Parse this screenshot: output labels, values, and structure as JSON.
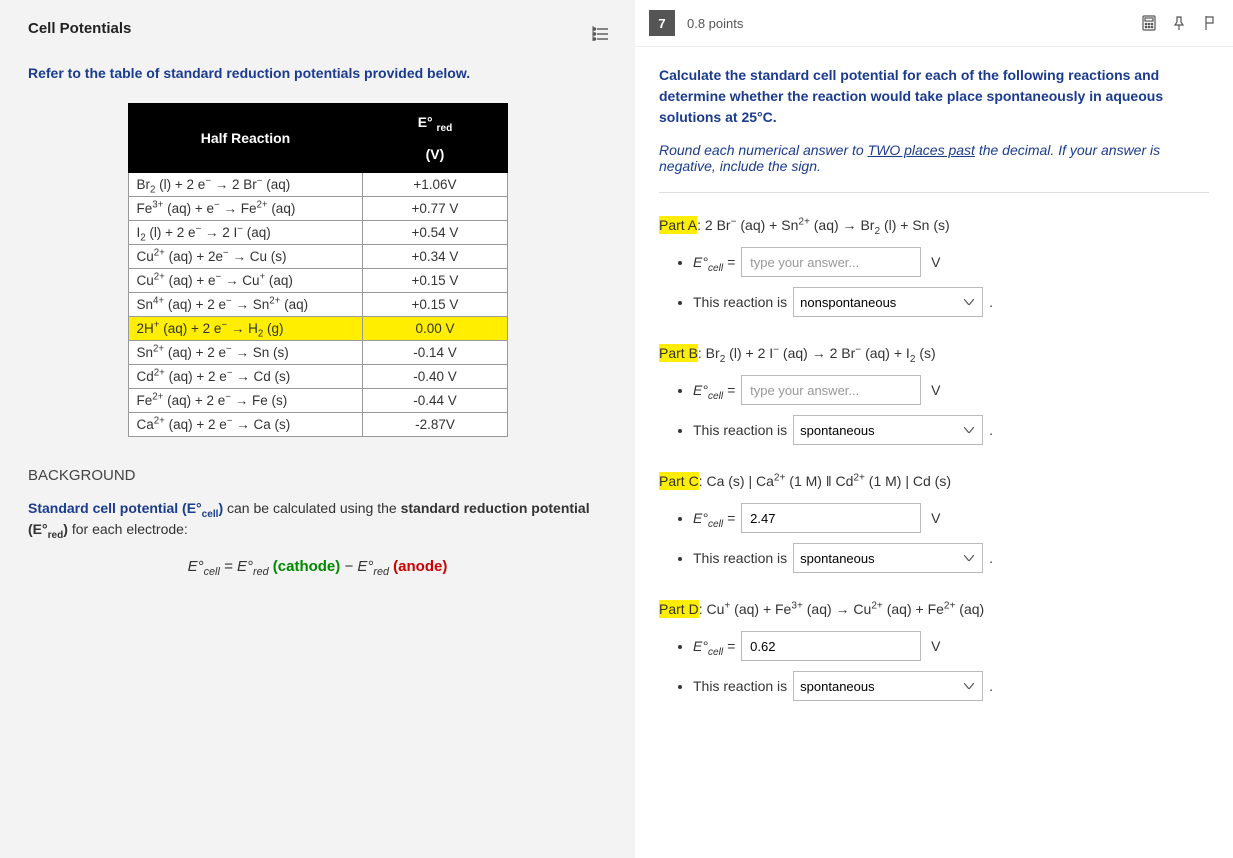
{
  "left": {
    "title": "Cell Potentials",
    "instruction": "Refer to the table of standard reduction potentials provided below.",
    "table": {
      "headers": {
        "reaction": "Half Reaction",
        "ered": "E° ",
        "ered_sub": "red",
        "unit": "(V)"
      },
      "rows": [
        {
          "rxn": "Br<sub>2</sub> (l) + 2 e<sup>−</sup> → 2 Br<sup>−</sup> (aq)",
          "v": "+1.06V",
          "hl": false
        },
        {
          "rxn": "Fe<sup>3+</sup> (aq) + e<sup>−</sup> → Fe<sup>2+</sup> (aq)",
          "v": "+0.77 V",
          "hl": false
        },
        {
          "rxn": "I<sub>2</sub> (l) + 2 e<sup>−</sup> → 2 I<sup>−</sup> (aq)",
          "v": "+0.54 V",
          "hl": false
        },
        {
          "rxn": "Cu<sup>2+</sup> (aq) + 2e<sup>−</sup> → Cu (s)",
          "v": "+0.34 V",
          "hl": false
        },
        {
          "rxn": "Cu<sup>2+</sup> (aq) + e<sup>−</sup> → Cu<sup>+</sup> (aq)",
          "v": "+0.15 V",
          "hl": false
        },
        {
          "rxn": "Sn<sup>4+</sup> (aq) + 2 e<sup>−</sup> → Sn<sup>2+</sup> (aq)",
          "v": "+0.15 V",
          "hl": false
        },
        {
          "rxn": "2H<sup>+</sup> (aq) + 2 e<sup>−</sup> → H<sub>2</sub> (g)",
          "v": "0.00 V",
          "hl": true
        },
        {
          "rxn": "Sn<sup>2+</sup> (aq) + 2 e<sup>−</sup> → Sn (s)",
          "v": "-0.14 V",
          "hl": false
        },
        {
          "rxn": "Cd<sup>2+</sup> (aq) + 2 e<sup>−</sup> → Cd (s)",
          "v": "-0.40 V",
          "hl": false
        },
        {
          "rxn": "Fe<sup>2+</sup> (aq) + 2 e<sup>−</sup> → Fe (s)",
          "v": "-0.44 V",
          "hl": false
        },
        {
          "rxn": "Ca<sup>2+</sup> (aq) + 2 e<sup>−</sup> → Ca (s)",
          "v": "-2.87V",
          "hl": false
        }
      ]
    },
    "background_heading": "BACKGROUND",
    "background_text": "<b class='blue'>Standard cell potential (E°<sub>cell</sub>)</b> can be calculated using the <b>standard reduction potential (E°<sub>red</sub>)</b> for each electrode:",
    "formula": "<i>E°<sub>cell</sub></i> = <i>E°<sub>red</sub></i> <span class='green'>(cathode)</span> − <i>E°<sub>red</sub></i> <span class='red'>(anode)</span>"
  },
  "right": {
    "question_number": "7",
    "points": "0.8 points",
    "intro": "Calculate the standard cell potential for each of the following reactions and determine whether the reaction would take place spontaneously in aqueous solutions at 25°C.",
    "round_note": "Round each numerical answer to <u>TWO places past</u> the decimal. If your answer is negative, include the sign.",
    "ecell_label": "E°<sub>cell</sub> =",
    "unit": "V",
    "reaction_is": "This reaction is",
    "placeholder": "type your answer...",
    "options": {
      "spont": "spontaneous",
      "nonspont": "nonspontaneous"
    },
    "parts": [
      {
        "label": "Part A",
        "rxn": ": 2 Br<sup>−</sup> (aq) + Sn<sup>2+</sup> (aq) → Br<sub>2</sub> (l) + Sn (s)",
        "value": "",
        "sel": "nonspontaneous"
      },
      {
        "label": "Part B",
        "rxn": ": Br<sub>2</sub> (l) + 2 I<sup>−</sup> (aq) → 2 Br<sup>−</sup> (aq) + I<sub>2</sub> (s)",
        "value": "",
        "sel": "spontaneous"
      },
      {
        "label": "Part C",
        "rxn": ": Ca (s) | Ca<sup>2+</sup> (1 M) ‖ Cd<sup>2+</sup> (1 M) | Cd (s)",
        "value": "2.47",
        "sel": "spontaneous"
      },
      {
        "label": "Part D",
        "rxn": ": Cu<sup>+</sup> (aq) + Fe<sup>3+</sup> (aq) → Cu<sup>2+</sup> (aq) + Fe<sup>2+</sup> (aq)",
        "value": "0.62",
        "sel": "spontaneous"
      }
    ]
  }
}
